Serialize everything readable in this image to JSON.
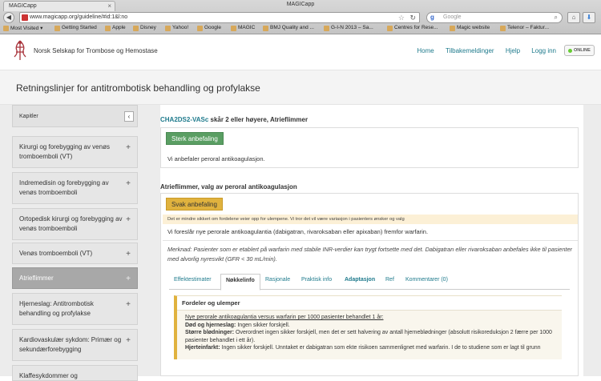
{
  "browser": {
    "window_title": "MAGICapp",
    "tab_title": "MAGICapp",
    "url": "www.magicapp.org/guideline/#id:1&l:no",
    "search_placeholder": "Google",
    "bookmarks": [
      "Most Visited ▾",
      "Getting Started",
      "Apple",
      "Disney",
      "Yahoo!",
      "Google",
      "MAGIC",
      "BMJ Quality and ...",
      "G-I-N 2013 – Sa...",
      "Centres for Rese...",
      "Magic website",
      "Telenor – Faktur..."
    ]
  },
  "header": {
    "org_name": "Norsk Selskap for Trombose og Hemostase",
    "nav": [
      "Home",
      "Tilbakemeldinger",
      "Hjelp",
      "Logg inn"
    ],
    "status": "ONLINE"
  },
  "page": {
    "title": "Retningslinjer for antitrombotisk behandling og profylakse"
  },
  "sidebar": {
    "header": "Kapitler",
    "items": [
      {
        "label": "Kirurgi og forebygging av venøs tromboemboli (VT)",
        "active": false
      },
      {
        "label": "Indremedisin og forebygging av venøs tromboemboli",
        "active": false
      },
      {
        "label": "Ortopedisk kirurgi og forebygging av venøs tromboemboli",
        "active": false
      },
      {
        "label": "Venøs tromboemboli (VT)",
        "active": false
      },
      {
        "label": "Atrieflimmer",
        "active": true
      },
      {
        "label": "Hjerneslag: Antitrombotisk behandling og profylakse",
        "active": false
      },
      {
        "label": "Kardiovaskulær sykdom: Primær og sekundærforebygging",
        "active": false
      },
      {
        "label": "Klaffesykdommer og",
        "active": false
      }
    ]
  },
  "rec1": {
    "heading_link": "CHA2DS2-VASc",
    "heading_rest": " skår 2 eller høyere, Atrieflimmer",
    "badge": "Sterk anbefaling",
    "text": "Vi anbefaler peroral antikoagulasjon."
  },
  "rec2": {
    "heading": "Atrieflimmer, valg av peroral antikoagulasjon",
    "badge": "Svak anbefaling",
    "note": "Det er mindre sikkert om fordelene veier opp for ulempene. Vi tror det vil være variasjon i pasienters ønsker og valg",
    "text": "Vi foreslår nye perorale antikoagulantia (dabigatran, rivaroksaban eller apixaban) fremfor warfarin.",
    "remark": "Merknad: Pasienter som er etablert på warfarin med stabile INR-verdier kan trygt fortsette med det. Dabigatran eller rivaroksaban anbefales ikke til pasienter med alvorlig nyresvikt (GFR < 30 mL/min)."
  },
  "tabs": [
    {
      "label": "Effektestimater",
      "selected": false
    },
    {
      "label": "Nøkkelinfo",
      "selected": true
    },
    {
      "label": "Rasjonale",
      "selected": false
    },
    {
      "label": "Praktisk info",
      "selected": false
    },
    {
      "label": "Adaptasjon",
      "selected": false
    },
    {
      "label": "Ref",
      "selected": false
    },
    {
      "label": "Kommentarer (0)",
      "selected": false
    }
  ],
  "panel": {
    "title": "Fordeler og ulemper",
    "line1": "Nye perorale antikoagulantia versus warfarin per 1000 pasienter behandlet 1 år:",
    "line2_b": "Død og hjerneslag:",
    "line2": " Ingen sikker forskjell.",
    "line3_b": "Større blødninger:",
    "line3": " Overordnet ingen sikker forskjell, men det er sett halvering av antall hjerneblødninger (absolutt risikoreduksjon 2 færre per 1000 pasienter behandlet i ett år).",
    "line4_b": "Hjerteinfarkt:",
    "line4": " Ingen sikker forskjell. Unntaket er dabigatran som ekte risikoen sammenlignet med warfarin. I de to studiene som er lagt til grunn"
  }
}
